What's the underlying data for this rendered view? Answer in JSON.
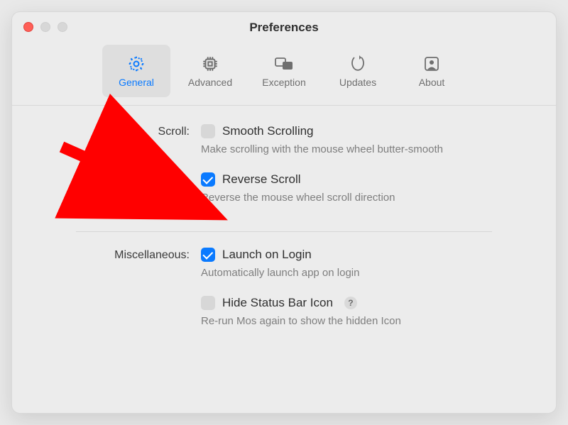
{
  "window": {
    "title": "Preferences"
  },
  "tabs": {
    "general": "General",
    "advanced": "Advanced",
    "exception": "Exception",
    "updates": "Updates",
    "about": "About"
  },
  "section_scroll": {
    "label": "Scroll:",
    "smooth_scrolling": {
      "label": "Smooth Scrolling",
      "desc": "Make scrolling with the mouse wheel butter-smooth",
      "checked": false
    },
    "reverse_scroll": {
      "label": "Reverse Scroll",
      "desc": "Reverse the mouse wheel scroll direction",
      "checked": true
    }
  },
  "section_misc": {
    "label": "Miscellaneous:",
    "launch_on_login": {
      "label": "Launch on Login",
      "desc": "Automatically launch app on login",
      "checked": true
    },
    "hide_status_icon": {
      "label": "Hide Status Bar Icon",
      "desc": "Re-run Mos again to show the hidden Icon",
      "checked": false,
      "help": "?"
    }
  }
}
